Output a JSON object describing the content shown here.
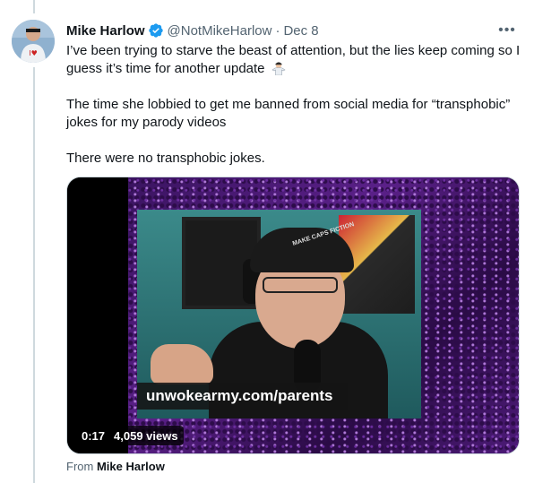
{
  "tweet": {
    "author_name": "Mike Harlow",
    "handle": "@NotMikeHarlow",
    "separator": "·",
    "date": "Dec 8",
    "more_icon": "more-horizontal-icon",
    "text_paragraph_1": "I’ve been trying to starve the beast of attention, but the lies keep coming so I guess it’s time for another update",
    "text_paragraph_2": "The time she lobbied to get me banned from social media for “transphobic” jokes for my parody videos",
    "text_paragraph_3": "There were no transphobic jokes."
  },
  "media": {
    "overlay_banner_text": "unwokearmy.com/parents",
    "cap_text": "MAKE CAPS FICTION",
    "video_time": "0:17",
    "views": "4,059 views"
  },
  "footer": {
    "source_prefix": "From",
    "source_name": "Mike Harlow"
  },
  "colors": {
    "verified_blue": "#1d9bf0",
    "secondary_text": "#536471",
    "primary_text": "#0f1419"
  }
}
